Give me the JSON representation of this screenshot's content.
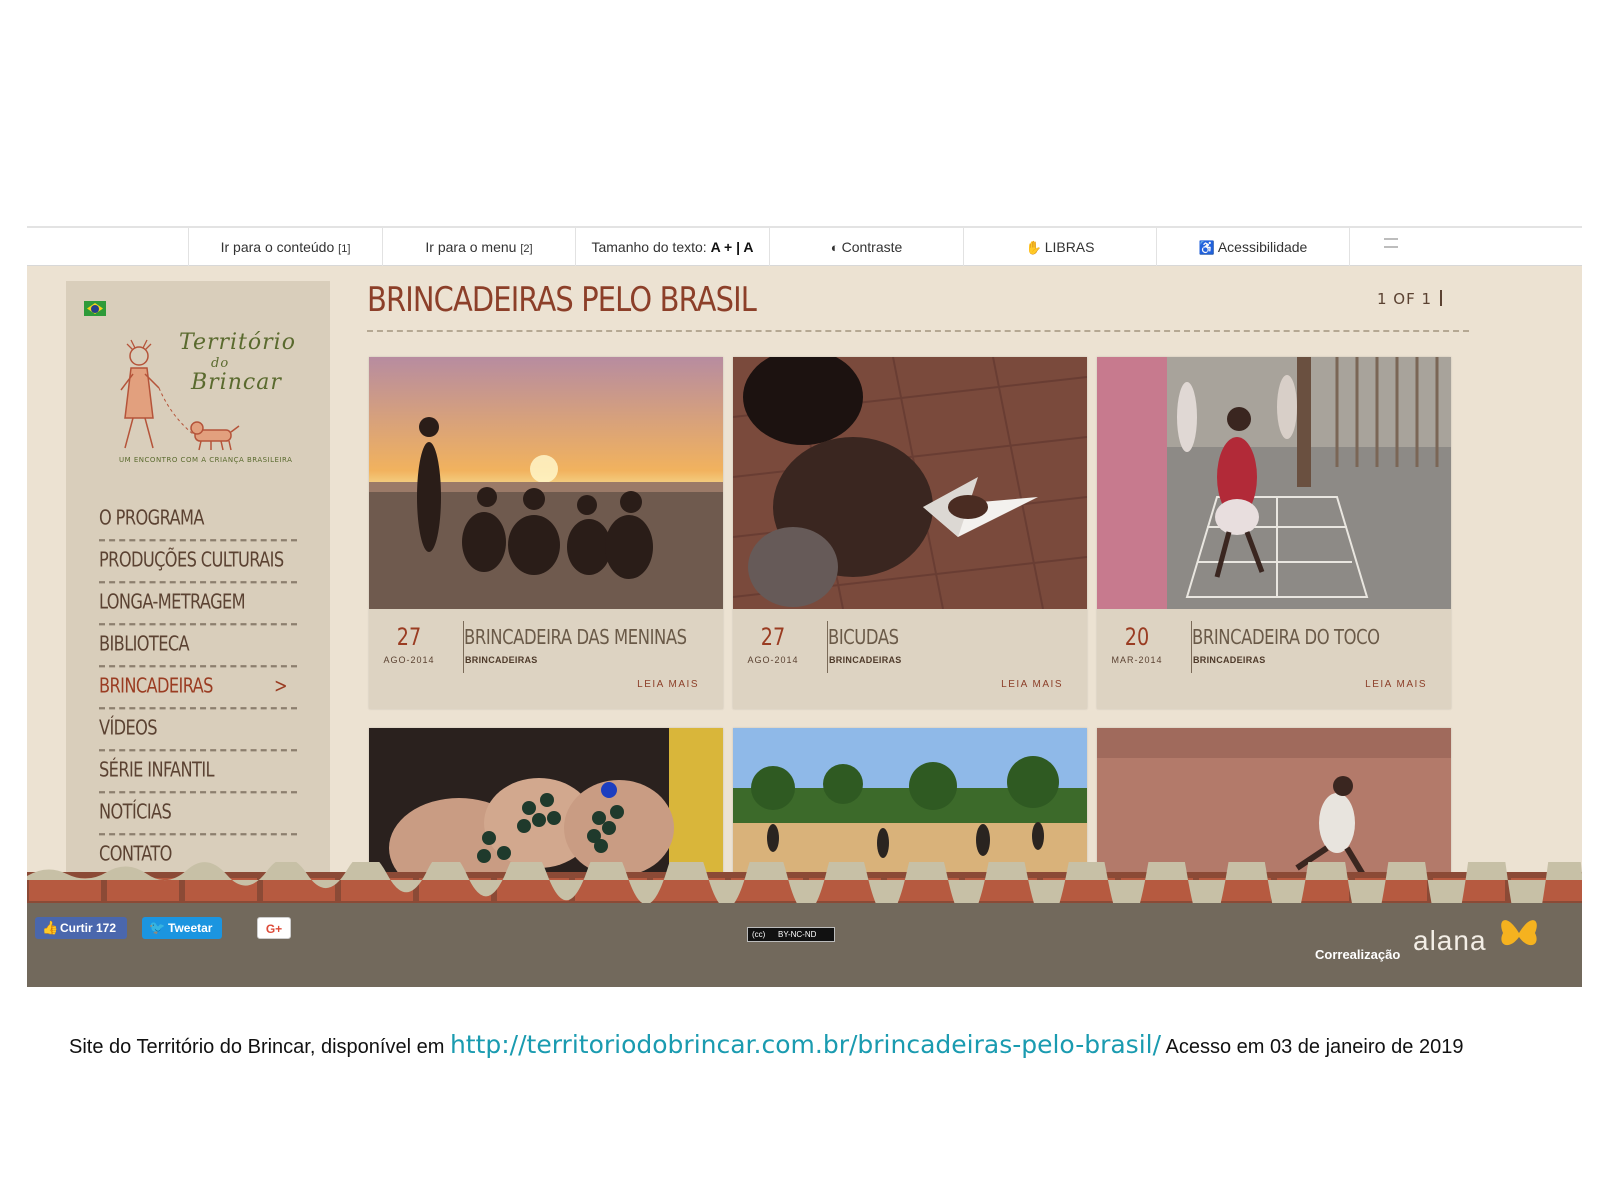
{
  "accessibility_bar": {
    "skip_content": "Ir para o conteúdo",
    "skip_content_key": "[1]",
    "skip_menu": "Ir para o menu",
    "skip_menu_key": "[2]",
    "text_size_label": "Tamanho do texto:",
    "text_size_controls": "A + | A",
    "contrast": "Contraste",
    "libras": "LIBRAS",
    "accessibility": "Acessibilidade"
  },
  "logo": {
    "word1": "Território",
    "word2": "do",
    "word3": "Brincar",
    "tagline": "UM ENCONTRO COM A CRIANÇA BRASILEIRA"
  },
  "nav": {
    "items": [
      {
        "label": "O PROGRAMA"
      },
      {
        "label": "PRODUÇÕES CULTURAIS"
      },
      {
        "label": "LONGA-METRAGEM"
      },
      {
        "label": "BIBLIOTECA"
      },
      {
        "label": "BRINCADEIRAS",
        "active": true
      },
      {
        "label": "VÍDEOS"
      },
      {
        "label": "SÉRIE INFANTIL"
      },
      {
        "label": "NOTÍCIAS"
      },
      {
        "label": "CONTATO"
      }
    ],
    "active_chevron": ">"
  },
  "main": {
    "title": "BRINCADEIRAS PELO BRASIL",
    "pager": "1 OF 1",
    "cards": [
      {
        "day": "27",
        "month": "AGO-2014",
        "title": "BRINCADEIRA DAS MENINAS",
        "category": "BRINCADEIRAS",
        "more": "LEIA MAIS",
        "image": "girls-at-sunset-beach"
      },
      {
        "day": "27",
        "month": "AGO-2014",
        "title": "BICUDAS",
        "category": "BRINCADEIRAS",
        "more": "LEIA MAIS",
        "image": "boy-folding-paper"
      },
      {
        "day": "20",
        "month": "MAR-2014",
        "title": "BRINCADEIRA DO TOCO",
        "category": "BRINCADEIRAS",
        "more": "LEIA MAIS",
        "image": "girl-hopscotch"
      },
      {
        "image": "hands-with-marbles"
      },
      {
        "image": "kids-running-field"
      },
      {
        "image": "boy-against-wall"
      }
    ]
  },
  "footer": {
    "facebook": "Curtir 172",
    "twitter": "Tweetar",
    "gplus": "G+",
    "cc_license": "BY-NC-ND",
    "cc_mark": "(cc)",
    "correalizacao": "Correalização",
    "partner": "alana"
  },
  "caption": {
    "prefix": "Site do Território do Brincar, disponível em",
    "link": "http://territoriodobrincar.com.br/brincadeiras-pelo-brasil/",
    "suffix": "Acesso em 03 de janeiro de 2019"
  },
  "colors": {
    "page_bg": "#ece2d2",
    "accent": "#9a3c22",
    "footer": "#72695c",
    "link": "#1a9bb0"
  }
}
